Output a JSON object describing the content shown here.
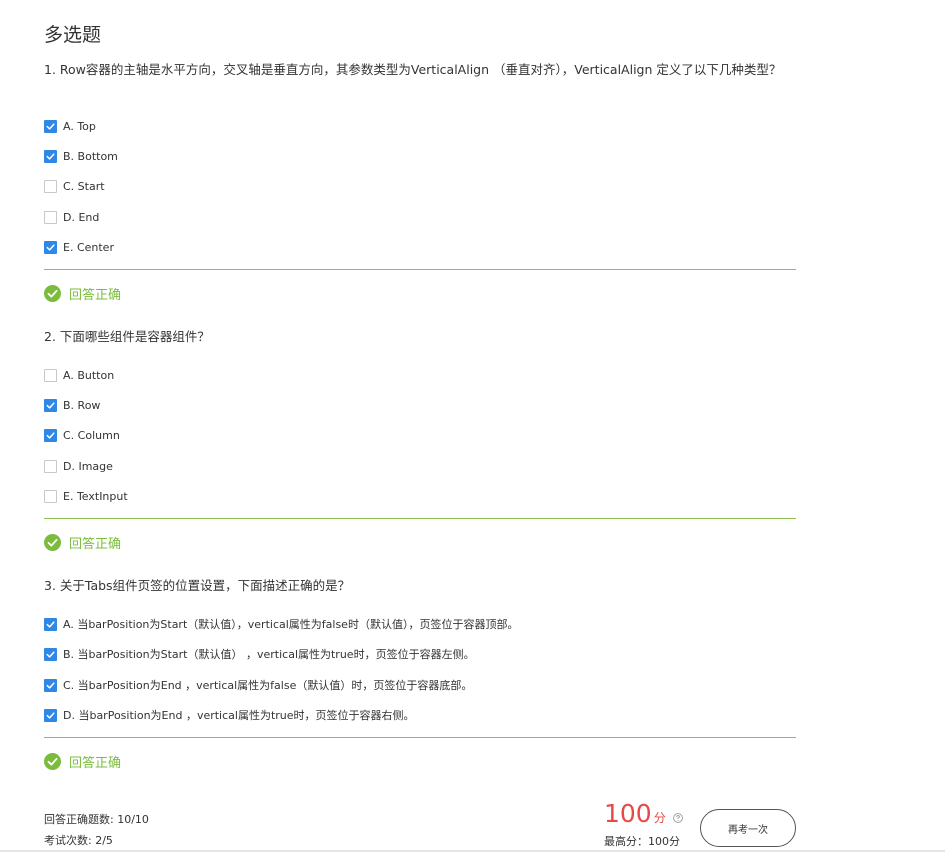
{
  "section_title": "多选题",
  "questions": [
    {
      "title": "1. Row容器的主轴是水平方向，交叉轴是垂直方向，其参数类型为VerticalAlign （垂直对齐），VerticalAlign 定义了以下几种类型？",
      "options": [
        {
          "label": "A. Top",
          "checked": true
        },
        {
          "label": "B. Bottom",
          "checked": true
        },
        {
          "label": "C. Start",
          "checked": false
        },
        {
          "label": "D. End",
          "checked": false
        },
        {
          "label": "E. Center",
          "checked": true
        }
      ],
      "result": "回答正确"
    },
    {
      "title": "2. 下面哪些组件是容器组件？",
      "options": [
        {
          "label": "A. Button",
          "checked": false
        },
        {
          "label": "B. Row",
          "checked": true
        },
        {
          "label": "C. Column",
          "checked": true
        },
        {
          "label": "D. Image",
          "checked": false
        },
        {
          "label": "E. TextInput",
          "checked": false
        }
      ],
      "result": "回答正确"
    },
    {
      "title": "3. 关于Tabs组件页签的位置设置，下面描述正确的是？",
      "options": [
        {
          "label": "A. 当barPosition为Start（默认值），vertical属性为false时（默认值），页签位于容器顶部。",
          "checked": true
        },
        {
          "label": "B. 当barPosition为Start（默认值） ，vertical属性为true时，页签位于容器左侧。",
          "checked": true
        },
        {
          "label": "C. 当barPosition为End ，vertical属性为false（默认值）时，页签位于容器底部。",
          "checked": true
        },
        {
          "label": "D. 当barPosition为End ，vertical属性为true时，页签位于容器右侧。",
          "checked": true
        }
      ],
      "result": "回答正确"
    }
  ],
  "footer": {
    "correct_count": "回答正确题数: 10/10",
    "attempts": "考试次数: 2/5",
    "score": "100",
    "score_unit": "分",
    "best_score": "最高分：100分",
    "retry_label": "再考一次"
  },
  "colors": {
    "accent_checkbox": "#2f88e6",
    "success": "#7cbc3d",
    "score": "#e64949"
  },
  "icons": {
    "checkbox_checked": "checkmark-icon",
    "result": "check-circle-icon",
    "help": "question-circle-icon"
  }
}
